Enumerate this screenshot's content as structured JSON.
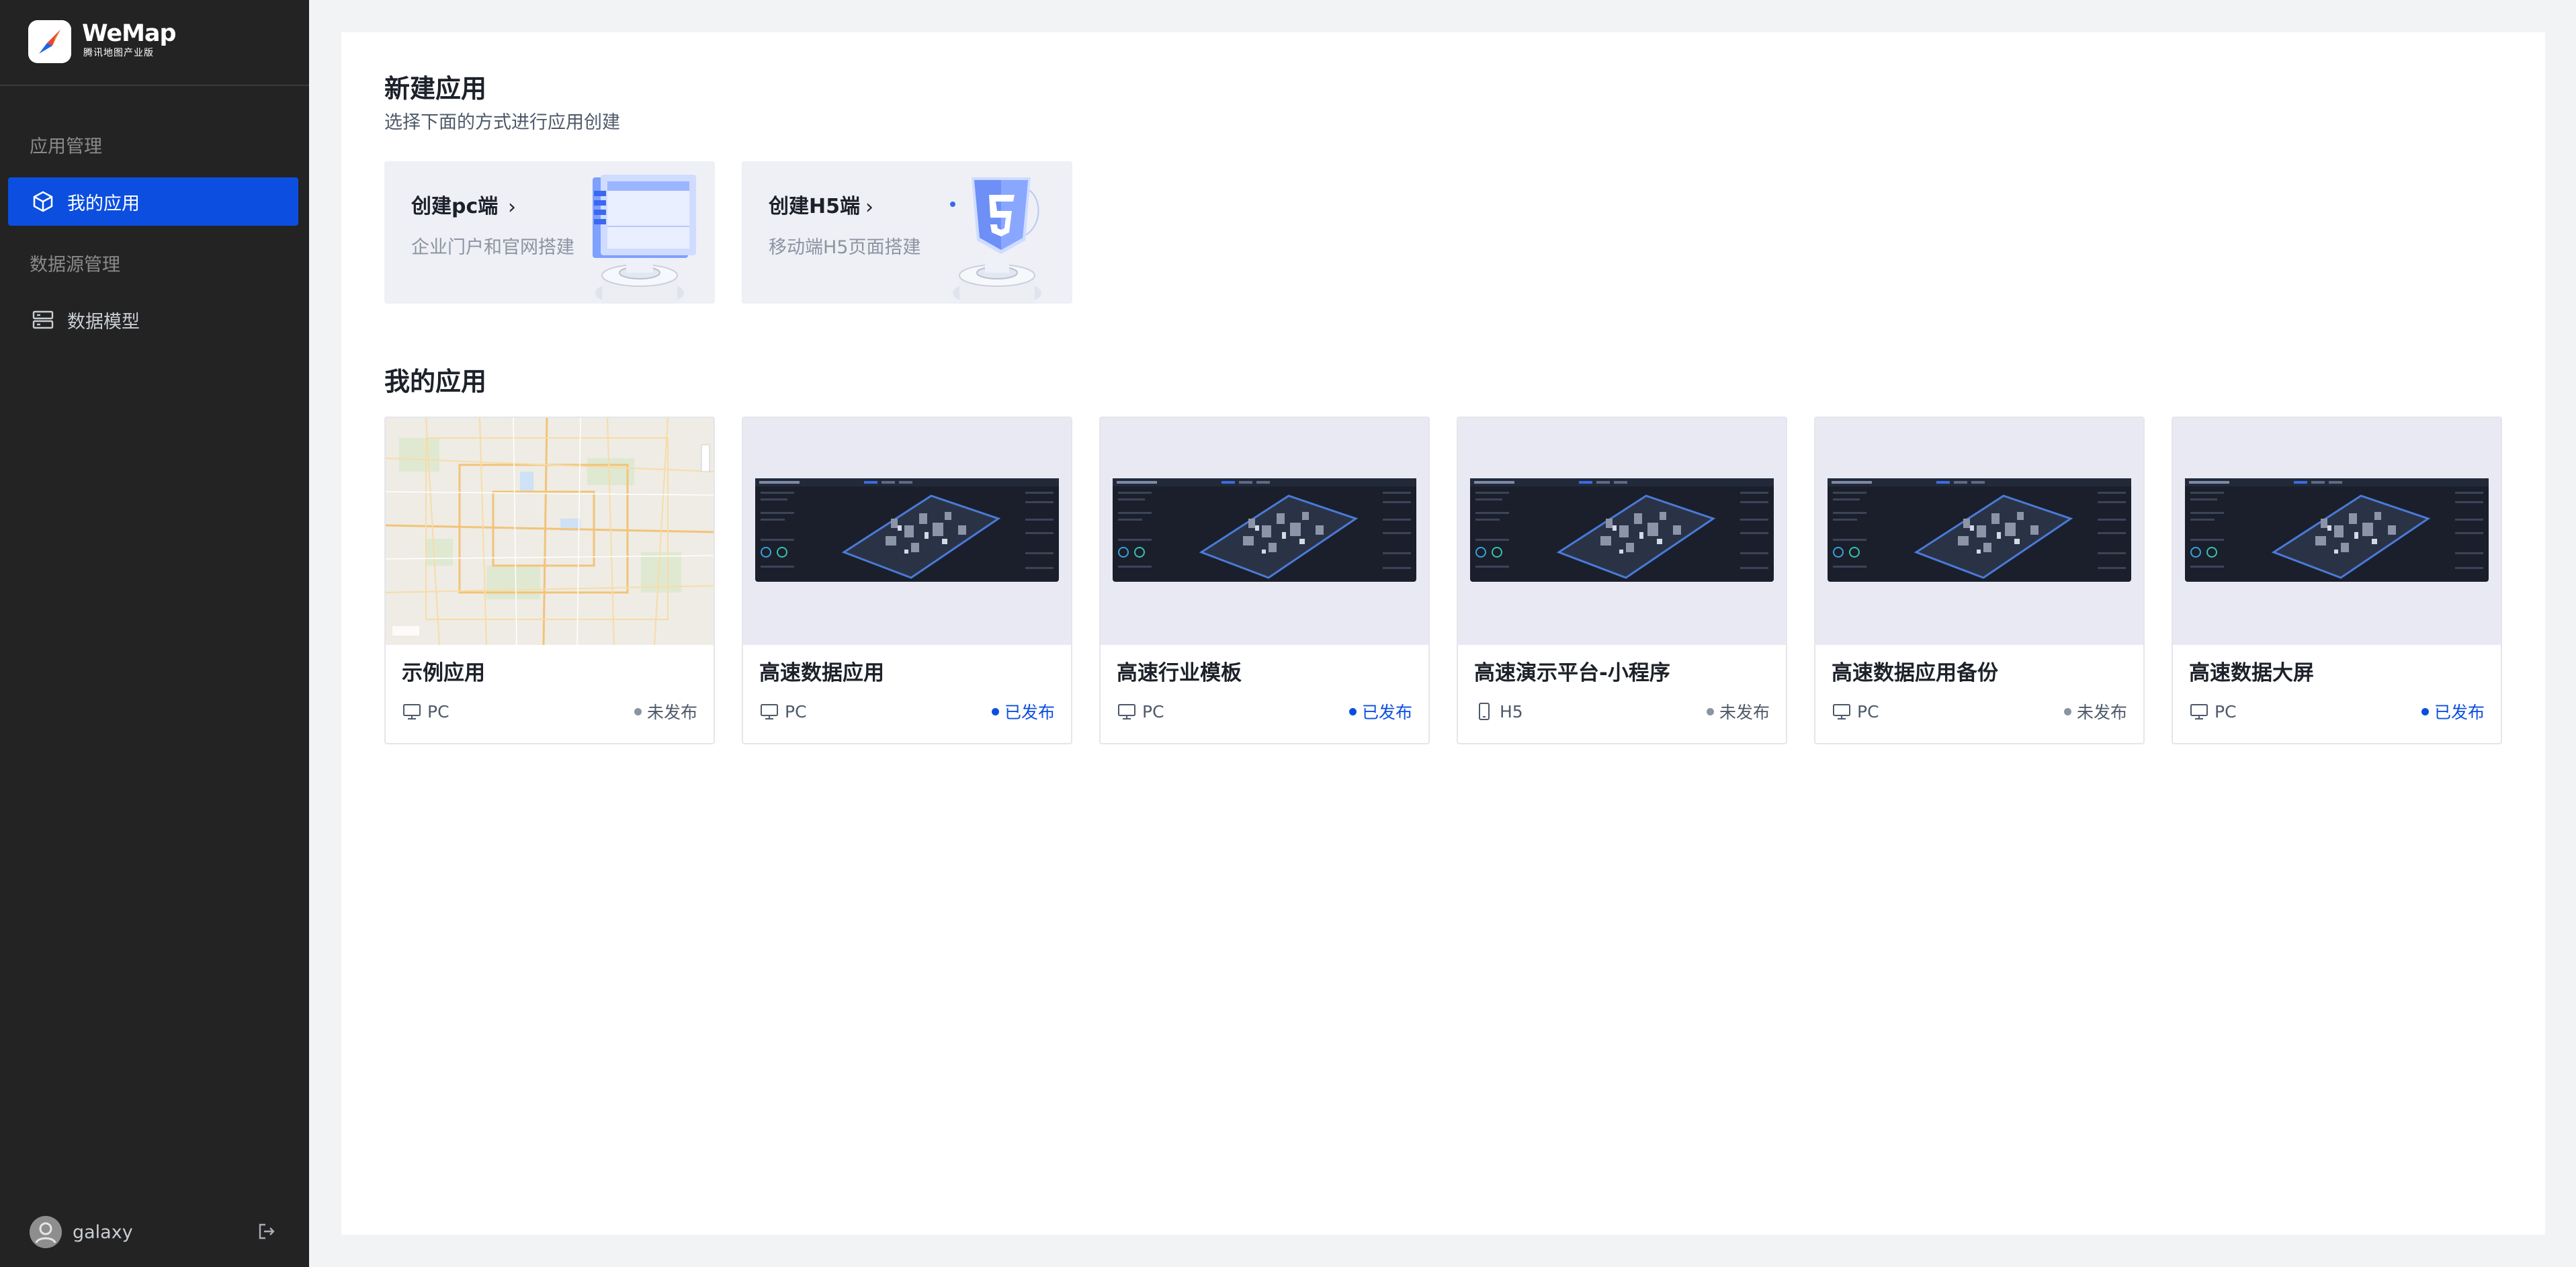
{
  "brand": {
    "name": "WeMap",
    "subtitle": "腾讯地图产业版"
  },
  "sidebar": {
    "groups": [
      {
        "label": "应用管理"
      },
      {
        "label": "数据源管理"
      }
    ],
    "items": [
      {
        "label": "我的应用",
        "icon": "cube-icon",
        "active": true
      },
      {
        "label": "数据模型",
        "icon": "database-icon",
        "active": false
      }
    ],
    "user": {
      "name": "galaxy"
    }
  },
  "create": {
    "title": "新建应用",
    "subtitle": "选择下面的方式进行应用创建",
    "cards": [
      {
        "title": "创建pc端",
        "arrow": "›",
        "desc": "企业门户和官网搭建"
      },
      {
        "title": "创建H5端",
        "arrow": "›",
        "desc": "移动端H5页面搭建"
      }
    ]
  },
  "apps": {
    "title": "我的应用",
    "items": [
      {
        "name": "示例应用",
        "type": "PC",
        "status": "未发布",
        "published": false
      },
      {
        "name": "高速数据应用",
        "type": "PC",
        "status": "已发布",
        "published": true
      },
      {
        "name": "高速行业模板",
        "type": "PC",
        "status": "已发布",
        "published": true
      },
      {
        "name": "高速演示平台-小程序",
        "type": "H5",
        "status": "未发布",
        "published": false
      },
      {
        "name": "高速数据应用备份",
        "type": "PC",
        "status": "未发布",
        "published": false
      },
      {
        "name": "高速数据大屏",
        "type": "PC",
        "status": "已发布",
        "published": true
      }
    ]
  },
  "colors": {
    "sidebar_bg": "#232323",
    "accent": "#0c4ee0",
    "page_bg": "#f2f3f5",
    "muted": "#8c93a1"
  }
}
